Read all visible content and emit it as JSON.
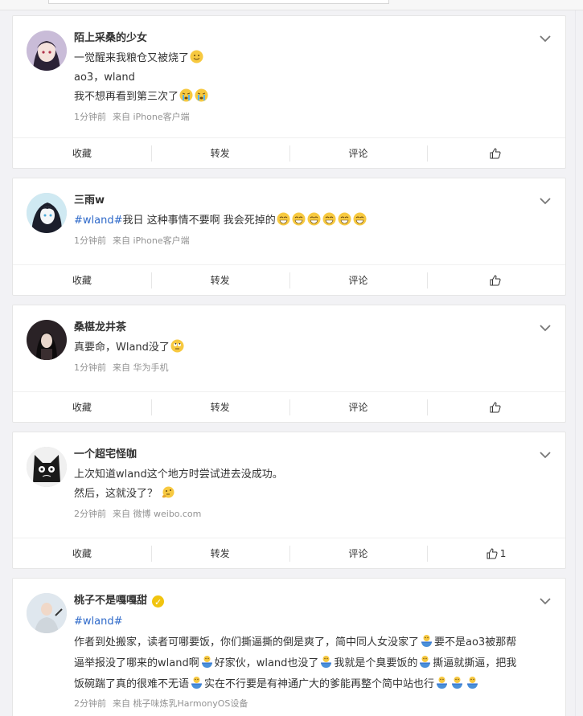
{
  "posts": [
    {
      "username": "陌上采桑的少女",
      "verified": false,
      "lines": [
        {
          "tag": "",
          "text": "一觉醒来我粮仓又被烧了",
          "emoji": [
            "smile"
          ]
        },
        {
          "tag": "",
          "text": "ao3，wland",
          "emoji": []
        },
        {
          "tag": "",
          "text": "我不想再看到第三次了",
          "emoji": [
            "cry",
            "cry"
          ]
        }
      ],
      "time": "1分钟前",
      "source": "来自 iPhone客户端",
      "actions": {
        "fav": "收藏",
        "repost": "转发",
        "comment": "评论",
        "like_count": ""
      }
    },
    {
      "username": "三雨w",
      "verified": false,
      "lines": [
        {
          "tag": "#wland#",
          "text": "我日 这种事情不要啊 我会死掉的",
          "emoji": [
            "grin",
            "grin",
            "grin",
            "grin",
            "grin",
            "grin"
          ]
        }
      ],
      "time": "1分钟前",
      "source": "来自 iPhone客户端",
      "actions": {
        "fav": "收藏",
        "repost": "转发",
        "comment": "评论",
        "like_count": ""
      }
    },
    {
      "username": "桑椹龙井茶",
      "verified": false,
      "lines": [
        {
          "tag": "",
          "text": "真要命，Wland没了",
          "emoji": [
            "eyeroll"
          ]
        }
      ],
      "time": "1分钟前",
      "source": "来自 华为手机",
      "actions": {
        "fav": "收藏",
        "repost": "转发",
        "comment": "评论",
        "like_count": ""
      }
    },
    {
      "username": "一个超宅怪咖",
      "verified": false,
      "lines": [
        {
          "tag": "",
          "text": "上次知道wland这个地方时尝试进去没成功。",
          "emoji": []
        },
        {
          "tag": "",
          "text": "然后，这就没了？ ",
          "emoji": [
            "think"
          ]
        }
      ],
      "time": "2分钟前",
      "source": "来自 微博 weibo.com",
      "actions": {
        "fav": "收藏",
        "repost": "转发",
        "comment": "评论",
        "like_count": "1"
      }
    },
    {
      "username": "桃子不是嘎嘎甜",
      "verified": true,
      "lines": [
        {
          "tag": "#wland#",
          "text": "",
          "emoji": []
        },
        {
          "tag": "",
          "text": "作者到处搬家，读者可哪要饭，你们撕逼撕的倒是爽了，简中同人女没家了",
          "emoji": [
            "bowl"
          ],
          "tail": "要不是ao3被那帮"
        },
        {
          "tag": "",
          "text": "逼举报没了哪来的wland啊",
          "emoji": [
            "bowl"
          ],
          "tail": "好家伙，wland也没了",
          "emoji2": [
            "bowl"
          ],
          "tail2": "我就是个臭要饭的",
          "emoji3": [
            "bowl"
          ],
          "tail3": "撕逼就撕逼，把我"
        },
        {
          "tag": "",
          "text": "饭碗踹了真的很难不无语",
          "emoji": [
            "bowl"
          ],
          "tail": "实在不行要是有神通广大的爹能再整个简中站也行",
          "emoji2": [
            "bowl",
            "bowl",
            "bowl"
          ]
        }
      ],
      "time": "2分钟前",
      "source": "来自 桃子味炼乳HarmonyOS设备",
      "actions": {
        "fav": "收藏",
        "repost": "转发",
        "comment": "评论",
        "like_count": ""
      }
    }
  ]
}
